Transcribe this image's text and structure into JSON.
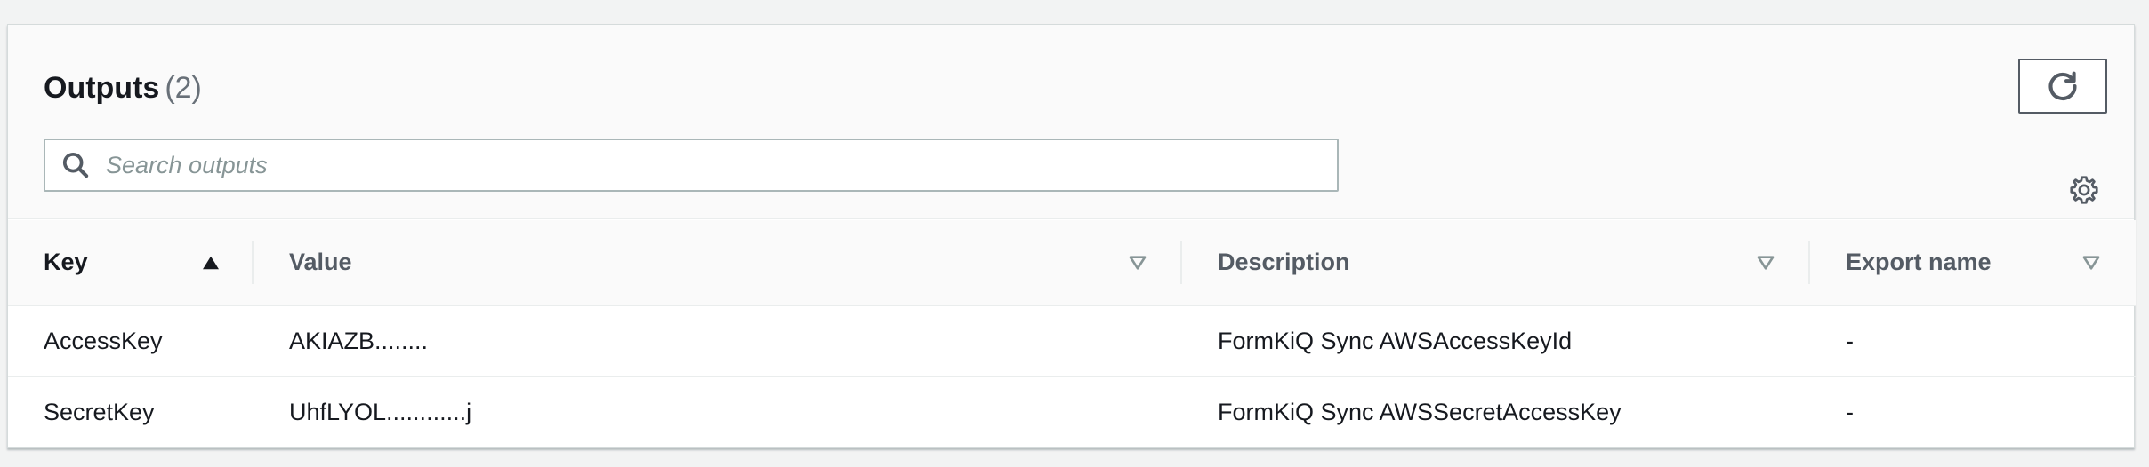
{
  "header": {
    "title": "Outputs",
    "count": "(2)",
    "refresh_icon": "refresh-icon",
    "settings_icon": "gear-icon"
  },
  "search": {
    "placeholder": "Search outputs",
    "value": "",
    "icon": "search-icon"
  },
  "table": {
    "columns": [
      {
        "label": "Key",
        "sort": "ascending"
      },
      {
        "label": "Value",
        "sort": "none"
      },
      {
        "label": "Description",
        "sort": "none"
      },
      {
        "label": "Export name",
        "sort": "none"
      }
    ],
    "rows": [
      {
        "key": "AccessKey",
        "value": "AKIAZB........",
        "description": "FormKiQ Sync AWSAccessKeyId",
        "export_name": "-"
      },
      {
        "key": "SecretKey",
        "value": "UhfLYOL............j",
        "description": "FormKiQ Sync AWSSecretAccessKey",
        "export_name": "-"
      }
    ]
  },
  "colors": {
    "sort_active": "#16191f",
    "sort_inactive": "#879596",
    "border": "#aab7b8"
  }
}
